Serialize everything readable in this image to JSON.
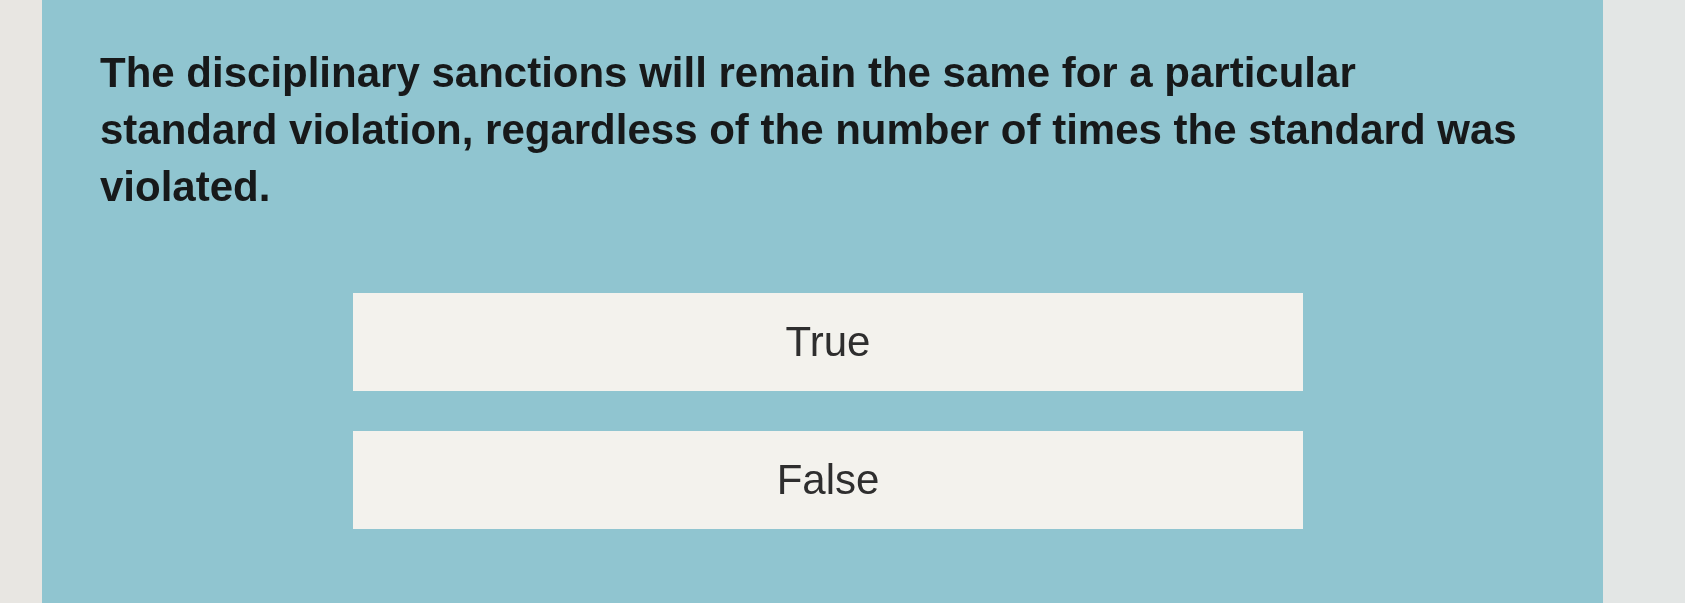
{
  "question": "The disciplinary sanctions will remain the same for a particular standard violation, regardless of the number of times the standard was violated.",
  "options": [
    {
      "label": "True",
      "selected": false
    },
    {
      "label": "False",
      "selected": false
    }
  ]
}
